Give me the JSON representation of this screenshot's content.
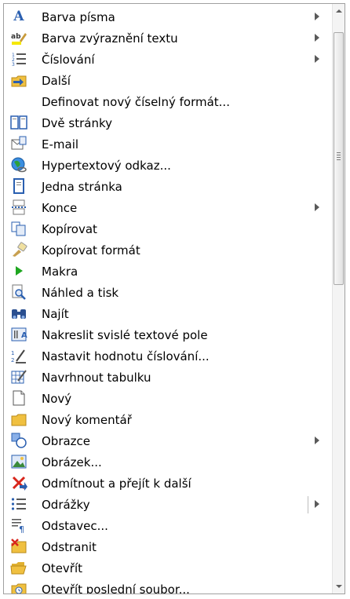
{
  "menu": {
    "items": [
      {
        "label": "Barva písma",
        "icon": "font-color-icon",
        "submenu": true
      },
      {
        "label": "Barva zvýraznění textu",
        "icon": "highlight-color-icon",
        "submenu": true
      },
      {
        "label": "Číslování",
        "icon": "numbering-icon",
        "submenu": true
      },
      {
        "label": "Další",
        "icon": "folder-next-icon",
        "submenu": false
      },
      {
        "label": "Definovat nový číselný formát...",
        "icon": "",
        "submenu": false
      },
      {
        "label": "Dvě stránky",
        "icon": "two-pages-icon",
        "submenu": false
      },
      {
        "label": "E-mail",
        "icon": "email-icon",
        "submenu": false
      },
      {
        "label": "Hypertextový odkaz...",
        "icon": "hyperlink-globe-icon",
        "submenu": false
      },
      {
        "label": "Jedna stránka",
        "icon": "one-page-icon",
        "submenu": false
      },
      {
        "label": "Konce",
        "icon": "breaks-icon",
        "submenu": true
      },
      {
        "label": "Kopírovat",
        "icon": "copy-icon",
        "submenu": false
      },
      {
        "label": "Kopírovat formát",
        "icon": "format-painter-icon",
        "submenu": false
      },
      {
        "label": "Makra",
        "icon": "play-macro-icon",
        "submenu": false
      },
      {
        "label": "Náhled a tisk",
        "icon": "print-preview-icon",
        "submenu": false
      },
      {
        "label": "Najít",
        "icon": "binoculars-icon",
        "submenu": false
      },
      {
        "label": "Nakreslit svislé textové pole",
        "icon": "vertical-textbox-icon",
        "submenu": false
      },
      {
        "label": "Nastavit hodnotu číslování...",
        "icon": "set-numbering-icon",
        "submenu": false
      },
      {
        "label": "Navrhnout tabulku",
        "icon": "draw-table-icon",
        "submenu": false
      },
      {
        "label": "Nový",
        "icon": "new-document-icon",
        "submenu": false
      },
      {
        "label": "Nový komentář",
        "icon": "new-comment-icon",
        "submenu": false
      },
      {
        "label": "Obrazce",
        "icon": "shapes-icon",
        "submenu": true
      },
      {
        "label": "Obrázek...",
        "icon": "picture-icon",
        "submenu": false
      },
      {
        "label": "Odmítnout a přejít k další",
        "icon": "reject-change-icon",
        "submenu": false
      },
      {
        "label": "Odrážky",
        "icon": "bullets-icon",
        "submenu": true,
        "split": true
      },
      {
        "label": "Odstavec...",
        "icon": "paragraph-icon",
        "submenu": false
      },
      {
        "label": "Odstranit",
        "icon": "delete-icon",
        "submenu": false
      },
      {
        "label": "Otevřít",
        "icon": "open-folder-icon",
        "submenu": false
      },
      {
        "label": "Otevřít poslední soubor...",
        "icon": "recent-file-icon",
        "submenu": false
      }
    ]
  },
  "colors": {
    "accent_blue": "#2a5fb0",
    "folder_yellow": "#f0c040",
    "red": "#d8261c",
    "green": "#1ea620"
  }
}
